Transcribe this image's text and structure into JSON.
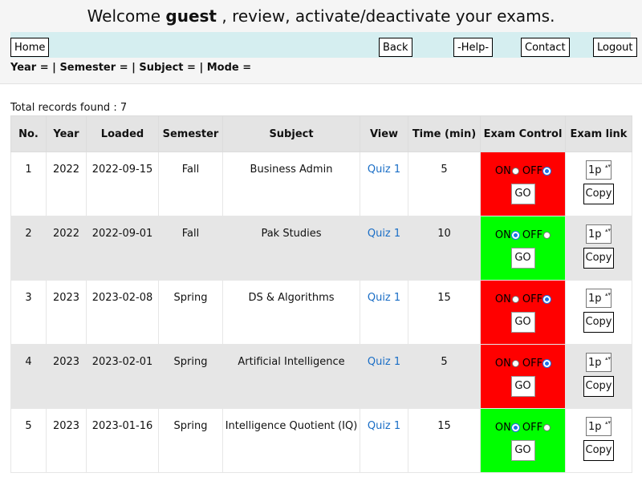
{
  "header": {
    "welcome_prefix": "Welcome ",
    "user": "guest",
    "welcome_suffix": " , review, activate/deactivate your exams."
  },
  "nav": {
    "home": "Home",
    "back": "Back",
    "help": "-Help-",
    "contact": "Contact",
    "logout": "Logout"
  },
  "filters": "Year = | Semester = | Subject = | Mode =",
  "total": "Total records found : 7",
  "columns": [
    "No.",
    "Year",
    "Loaded",
    "Semester",
    "Subject",
    "View",
    "Time (min)",
    "Exam Control",
    "Exam link"
  ],
  "control": {
    "on": "ON",
    "off": "OFF",
    "go": "GO",
    "copy": "Copy",
    "link_value": "1p"
  },
  "colors": {
    "off": "#ff0000",
    "on": "#00ff00",
    "link": "#1a6ec6",
    "nav": "#d5eef0"
  },
  "rows": [
    {
      "no": "1",
      "year": "2022",
      "loaded": "2022-09-15",
      "semester": "Fall",
      "subject": "Business Admin",
      "view": "Quiz 1",
      "time": "5",
      "state": "off"
    },
    {
      "no": "2",
      "year": "2022",
      "loaded": "2022-09-01",
      "semester": "Fall",
      "subject": "Pak Studies",
      "view": "Quiz 1",
      "time": "10",
      "state": "on"
    },
    {
      "no": "3",
      "year": "2023",
      "loaded": "2023-02-08",
      "semester": "Spring",
      "subject": "DS & Algorithms",
      "view": "Quiz 1",
      "time": "15",
      "state": "off"
    },
    {
      "no": "4",
      "year": "2023",
      "loaded": "2023-02-01",
      "semester": "Spring",
      "subject": "Artificial Intelligence",
      "view": "Quiz 1",
      "time": "5",
      "state": "off"
    },
    {
      "no": "5",
      "year": "2023",
      "loaded": "2023-01-16",
      "semester": "Spring",
      "subject": "Intelligence Quotient (IQ)",
      "view": "Quiz 1",
      "time": "15",
      "state": "on"
    }
  ]
}
